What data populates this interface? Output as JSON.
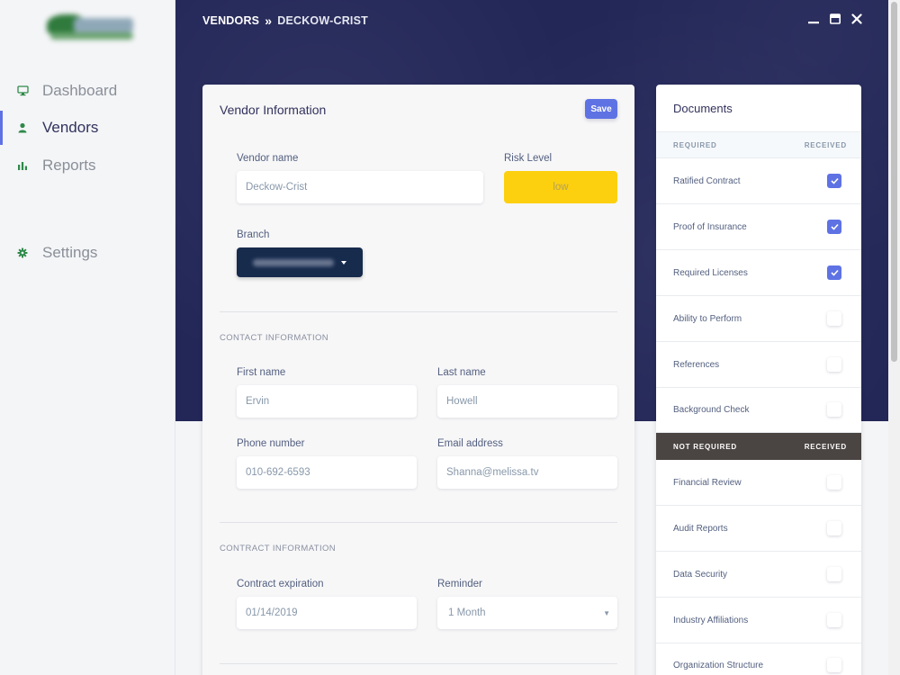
{
  "nav": {
    "items": [
      {
        "label": "Dashboard",
        "icon": "monitor-icon",
        "active": false
      },
      {
        "label": "Vendors",
        "icon": "user-icon",
        "active": true
      },
      {
        "label": "Reports",
        "icon": "bar-chart-icon",
        "active": false
      },
      {
        "label": "Settings",
        "icon": "gear-icon",
        "active": false
      }
    ]
  },
  "header": {
    "breadcrumb_root": "VENDORS",
    "breadcrumb_sep": "»",
    "breadcrumb_current": "DECKOW-CRIST"
  },
  "vendor_card": {
    "title": "Vendor Information",
    "save_label": "Save",
    "vendor_name_label": "Vendor name",
    "vendor_name_value": "Deckow-Crist",
    "risk_label": "Risk Level",
    "risk_value": "low",
    "branch_label": "Branch",
    "contact_section": "CONTACT INFORMATION",
    "first_name_label": "First name",
    "first_name_value": "Ervin",
    "last_name_label": "Last name",
    "last_name_value": "Howell",
    "phone_label": "Phone number",
    "phone_value": "010-692-6593",
    "email_label": "Email address",
    "email_value": "Shanna@melissa.tv",
    "contract_section": "CONTRACT INFORMATION",
    "expiration_label": "Contract expiration",
    "expiration_value": "01/14/2019",
    "reminder_label": "Reminder",
    "reminder_value": "1 Month"
  },
  "documents": {
    "title": "Documents",
    "required_header": "REQUIRED",
    "not_required_header": "NOT REQUIRED",
    "received_header": "RECEIVED",
    "required": [
      {
        "label": "Ratified Contract",
        "received": true
      },
      {
        "label": "Proof of Insurance",
        "received": true
      },
      {
        "label": "Required Licenses",
        "received": true
      },
      {
        "label": "Ability to Perform",
        "received": false
      },
      {
        "label": "References",
        "received": false
      },
      {
        "label": "Background Check",
        "received": false
      }
    ],
    "not_required": [
      {
        "label": "Financial Review",
        "received": false
      },
      {
        "label": "Audit Reports",
        "received": false
      },
      {
        "label": "Data Security",
        "received": false
      },
      {
        "label": "Industry Affiliations",
        "received": false
      },
      {
        "label": "Organization Structure",
        "received": false
      }
    ]
  },
  "colors": {
    "accent": "#5e72e4",
    "hero": "#232758",
    "risk_low": "#fdd00f",
    "branch_button": "#172b4d",
    "not_required_header": "#4a4542"
  }
}
